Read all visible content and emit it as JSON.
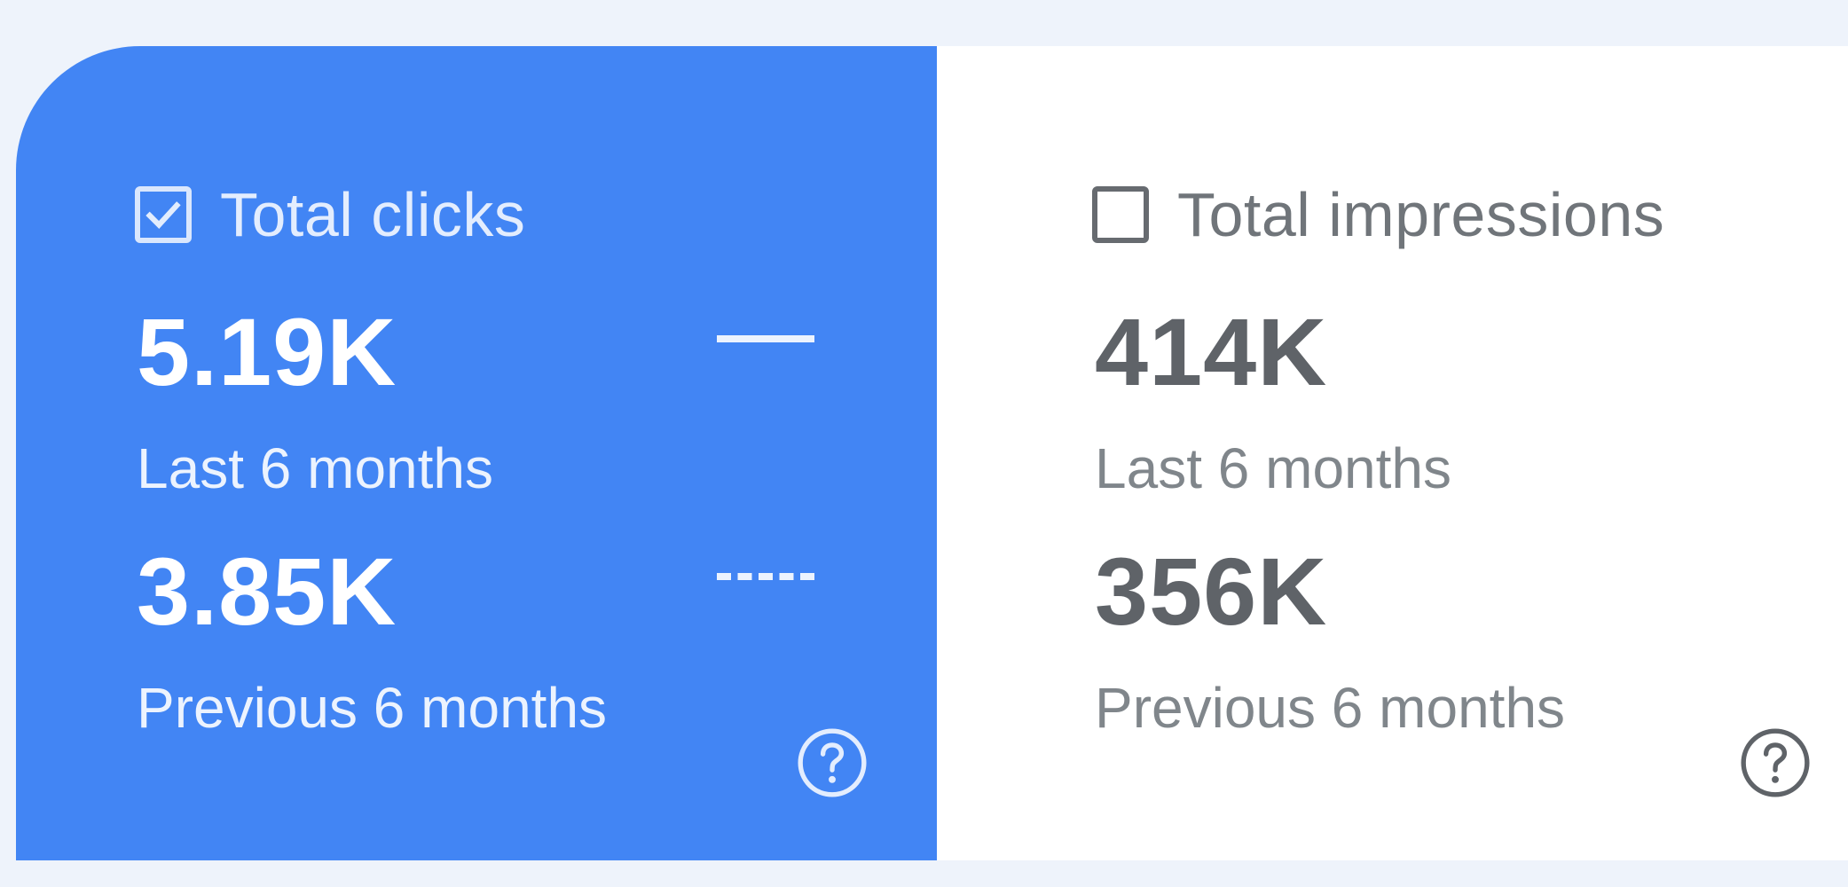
{
  "metrics": [
    {
      "title": "Total clicks",
      "checked": true,
      "current_value": "5.19K",
      "current_period": "Last 6 months",
      "previous_value": "3.85K",
      "previous_period": "Previous 6 months",
      "help_icon": "help-circle-icon",
      "color": "#4285f4"
    },
    {
      "title": "Total impressions",
      "checked": false,
      "current_value": "414K",
      "current_period": "Last 6 months",
      "previous_value": "356K",
      "previous_period": "Previous 6 months",
      "help_icon": "help-circle-icon",
      "color": "#ffffff"
    }
  ]
}
